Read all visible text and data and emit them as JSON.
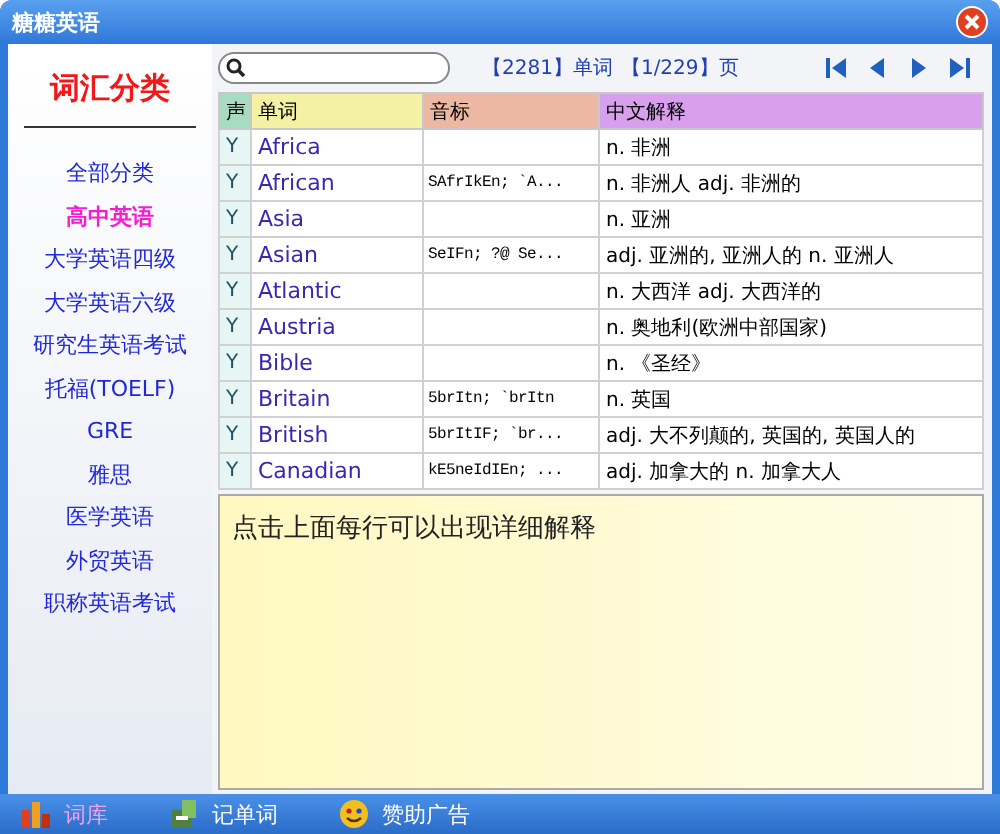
{
  "window": {
    "title": "糖糖英语"
  },
  "sidebar": {
    "title": "词汇分类",
    "items": [
      {
        "label": "全部分类",
        "selected": false
      },
      {
        "label": "高中英语",
        "selected": true
      },
      {
        "label": "大学英语四级",
        "selected": false
      },
      {
        "label": "大学英语六级",
        "selected": false
      },
      {
        "label": "研究生英语考试",
        "selected": false
      },
      {
        "label": "托福(TOELF)",
        "selected": false
      },
      {
        "label": "GRE",
        "selected": false
      },
      {
        "label": "雅思",
        "selected": false
      },
      {
        "label": "医学英语",
        "selected": false
      },
      {
        "label": "外贸英语",
        "selected": false
      },
      {
        "label": "职称英语考试",
        "selected": false
      }
    ]
  },
  "pager": {
    "count": "【2281】单词",
    "page": "【1/229】页"
  },
  "table": {
    "columns": [
      "声",
      "单词",
      "音标",
      "中文解释"
    ],
    "rows": [
      {
        "sound": "Y",
        "word": "Africa",
        "phonetic": "",
        "meaning": "n. 非洲"
      },
      {
        "sound": "Y",
        "word": "African",
        "phonetic": "SAfrIkEn; `A...",
        "meaning": "n. 非洲人 adj. 非洲的"
      },
      {
        "sound": "Y",
        "word": "Asia",
        "phonetic": "",
        "meaning": "n. 亚洲"
      },
      {
        "sound": "Y",
        "word": "Asian",
        "phonetic": "SeIFn; ?@ Se...",
        "meaning": "adj. 亚洲的, 亚洲人的 n. 亚洲人"
      },
      {
        "sound": "Y",
        "word": "Atlantic",
        "phonetic": "",
        "meaning": "n. 大西洋 adj. 大西洋的"
      },
      {
        "sound": "Y",
        "word": "Austria",
        "phonetic": "",
        "meaning": "n. 奥地利(欧洲中部国家)"
      },
      {
        "sound": "Y",
        "word": "Bible",
        "phonetic": "",
        "meaning": "n. 《圣经》"
      },
      {
        "sound": "Y",
        "word": "Britain",
        "phonetic": "5brItn; `brItn",
        "meaning": "n. 英国"
      },
      {
        "sound": "Y",
        "word": "British",
        "phonetic": "5brItIF; `br...",
        "meaning": "adj. 大不列颠的, 英国的, 英国人的"
      },
      {
        "sound": "Y",
        "word": "Canadian",
        "phonetic": "kE5neIdIEn; ...",
        "meaning": "adj. 加拿大的 n. 加拿大人"
      }
    ]
  },
  "detail": {
    "text": "点击上面每行可以出现详细解释"
  },
  "bottom_bar": [
    {
      "label": "词库",
      "kind": "library",
      "selected": true
    },
    {
      "label": "记单词",
      "kind": "memorize",
      "selected": false
    },
    {
      "label": "赞助广告",
      "kind": "sponsor",
      "selected": false
    }
  ]
}
